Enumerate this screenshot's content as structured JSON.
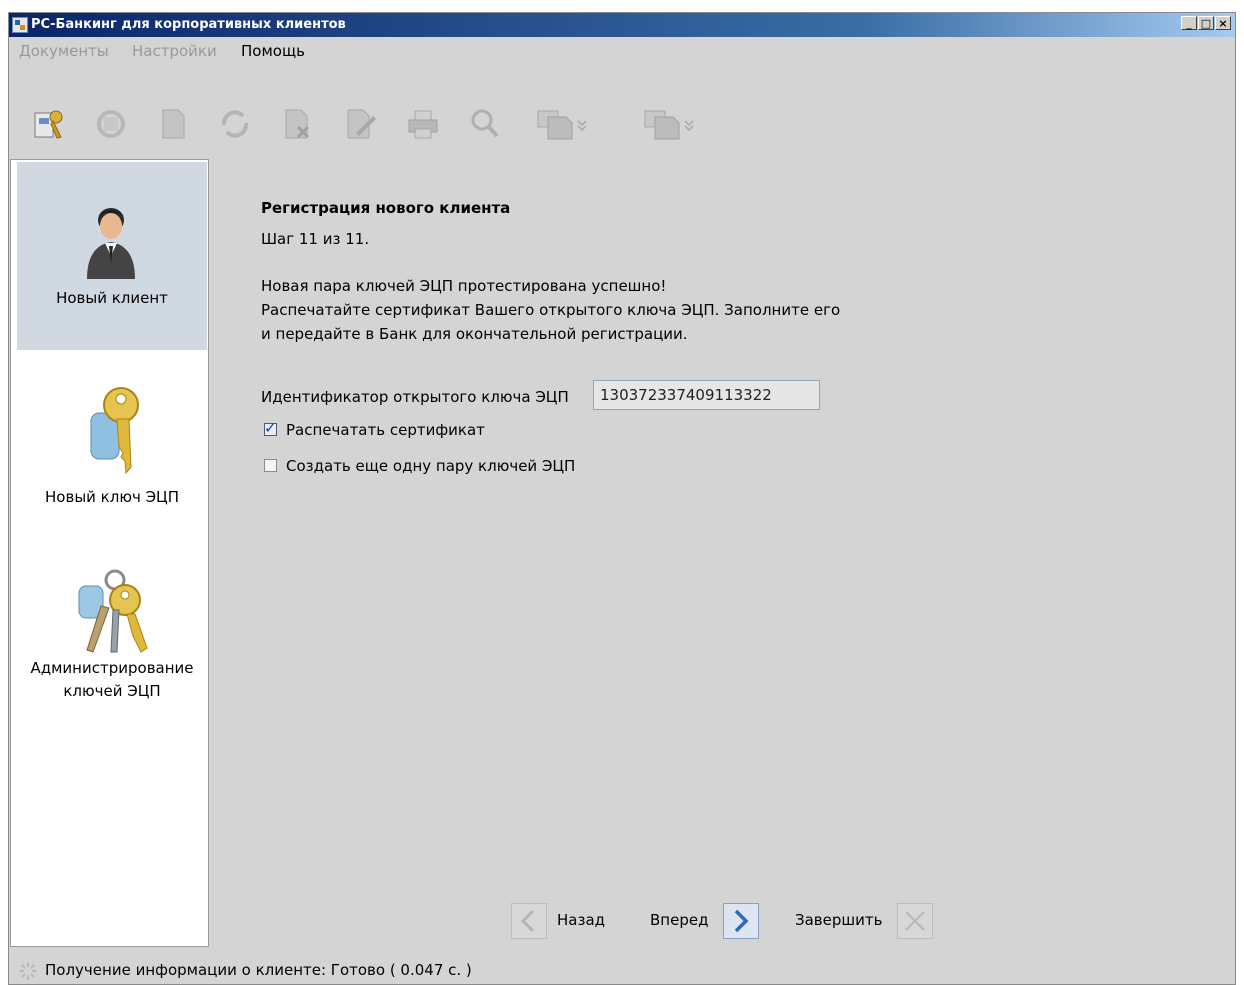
{
  "window": {
    "title": "РС-Банкинг для корпоративных клиентов",
    "min_label": "_",
    "max_label": "□",
    "close_label": "×"
  },
  "menu": [
    {
      "label": "Документы",
      "enabled": false
    },
    {
      "label": "Настройки",
      "enabled": false
    },
    {
      "label": "Помощь",
      "enabled": true
    }
  ],
  "toolbar_icons": [
    "login-icon",
    "sync-icon",
    "document-icon",
    "refresh-icon",
    "delete-document-icon",
    "edit-document-icon",
    "print-icon",
    "search-icon",
    "import-icon",
    "export-icon"
  ],
  "nav": [
    {
      "label": "Новый клиент",
      "selected": true,
      "icon": "user-icon"
    },
    {
      "label": "Новый ключ ЭЦП",
      "selected": false,
      "icon": "key-icon"
    },
    {
      "label_line1": "Администрирование",
      "label_line2": "ключей ЭЦП",
      "selected": false,
      "icon": "keys-bunch-icon"
    }
  ],
  "wizard": {
    "title": "Регистрация нового клиента",
    "step": "Шаг 11 из 11.",
    "msg1": "Новая пара ключей ЭЦП протестирована успешно!",
    "msg2": "Распечатайте сертификат Вашего открытого ключа ЭЦП. Заполните его",
    "msg3": "и передайте в Банк для окончательной регистрации.",
    "id_label": "Идентификатор открытого ключа ЭЦП",
    "id_value": "130372337409113322",
    "print_cert": {
      "label": "Распечатать сертификат",
      "checked": true
    },
    "create_more": {
      "label": "Создать еще одну пару ключей ЭЦП",
      "checked": false
    }
  },
  "footer": {
    "back": "Назад",
    "next": "Вперед",
    "finish": "Завершить"
  },
  "status": {
    "text": "Получение информации о клиенте: Готово ( 0.047 с. )"
  },
  "colors": {
    "title_bar": "#0a246a",
    "selected_nav": "#d0d8e2",
    "panel_bg": "#d4d4d4"
  }
}
